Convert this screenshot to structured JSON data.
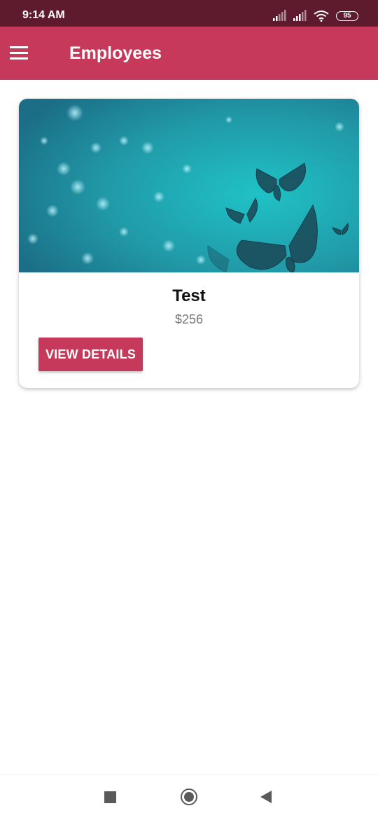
{
  "status_bar": {
    "time": "9:14 AM",
    "battery_level": "95",
    "icons": [
      "cell-signal-icon",
      "cell-signal-icon",
      "wifi-icon",
      "battery-icon"
    ]
  },
  "app_bar": {
    "title": "Employees",
    "menu_icon": "hamburger-menu-icon",
    "background_color": "#c6395a"
  },
  "cards": [
    {
      "image": "butterflies-teal-bokeh",
      "title": "Test",
      "price": "$256",
      "button_label": "VIEW DETAILS"
    }
  ],
  "nav_bar": {
    "icons": [
      "recent-apps-icon",
      "home-icon",
      "back-icon"
    ]
  },
  "colors": {
    "status_bar": "#5e1b2d",
    "accent": "#c6395a",
    "image_teal": "#2bb2bc",
    "price_text": "#777777"
  }
}
